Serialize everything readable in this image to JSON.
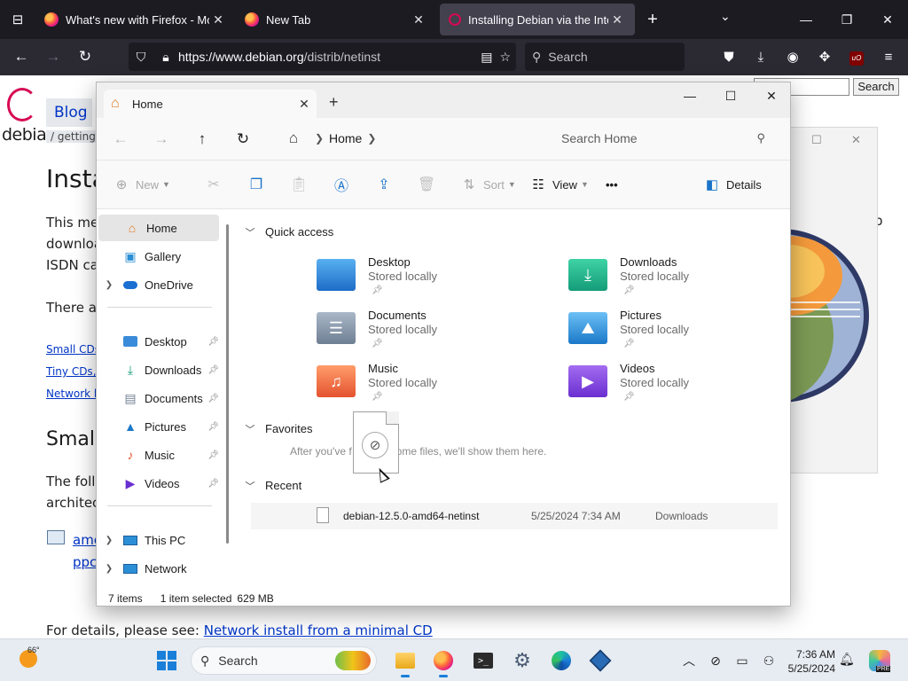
{
  "browser": {
    "tabs": [
      {
        "label": "What's new with Firefox - More",
        "close": "✕",
        "active": false
      },
      {
        "label": "New Tab",
        "close": "✕",
        "active": false
      },
      {
        "label": "Installing Debian via the Interne",
        "close": "✕",
        "active": true
      }
    ],
    "new_tab": "+",
    "url_host": "https://www.debian.org",
    "url_path": "/distrib/netinst",
    "search_placeholder": "Search"
  },
  "debian_page": {
    "logo_text": "debian",
    "blog_tab": "Blog",
    "breadcrumb": "/ getting",
    "search_button": "Search",
    "heading": "Insta",
    "para_lines": [
      "This me",
      "downloa",
      "ISDN ca"
    ],
    "para2": "There a",
    "links": [
      "Small CDs",
      "Tiny CDs,",
      "Network b"
    ],
    "subheading": "Small",
    "para3_lines": [
      "The follo",
      "architect"
    ],
    "amd_lines": [
      "amc",
      "ppc"
    ],
    "right_text": [
      "p",
      "l"
    ],
    "details_text": "For details, please see: ",
    "details_link": "Network install from a minimal CD"
  },
  "explorer": {
    "tab_title": "Home",
    "address_crumb": "Home",
    "search_placeholder": "Search Home",
    "toolbar": {
      "new_label": "New",
      "sort_label": "Sort",
      "view_label": "View",
      "more_label": "•••",
      "details_label": "Details"
    },
    "sidebar": {
      "top": [
        {
          "label": "Home",
          "selected": true
        },
        {
          "label": "Gallery"
        },
        {
          "label": "OneDrive"
        }
      ],
      "pinned": [
        "Desktop",
        "Downloads",
        "Documents",
        "Pictures",
        "Music",
        "Videos"
      ],
      "bottom": [
        "This PC",
        "Network"
      ]
    },
    "sections": {
      "quick_access": "Quick access",
      "favorites": "Favorites",
      "recent": "Recent"
    },
    "quick_access": [
      {
        "name": "Desktop",
        "sub": "Stored locally"
      },
      {
        "name": "Downloads",
        "sub": "Stored locally"
      },
      {
        "name": "Documents",
        "sub": "Stored locally"
      },
      {
        "name": "Pictures",
        "sub": "Stored locally"
      },
      {
        "name": "Music",
        "sub": "Stored locally"
      },
      {
        "name": "Videos",
        "sub": "Stored locally"
      }
    ],
    "favorites_empty_a": "After you've f",
    "favorites_empty_b": "ome files, we'll show them here.",
    "recent": [
      {
        "name": "debian-12.5.0-amd64-netinst",
        "date": "5/25/2024 7:34 AM",
        "location": "Downloads"
      }
    ],
    "status": {
      "items": "7 items",
      "selected": "1 item selected",
      "size": "629 MB"
    }
  },
  "taskbar": {
    "weather_temp": "66°",
    "search_label": "Search",
    "time": "7:36 AM",
    "date": "5/25/2024",
    "copilot_badge": "PRE"
  },
  "colors": {
    "accent": "#1a7fd9",
    "firefox_chrome": "#1c1b22",
    "debian_red": "#d70a53"
  }
}
